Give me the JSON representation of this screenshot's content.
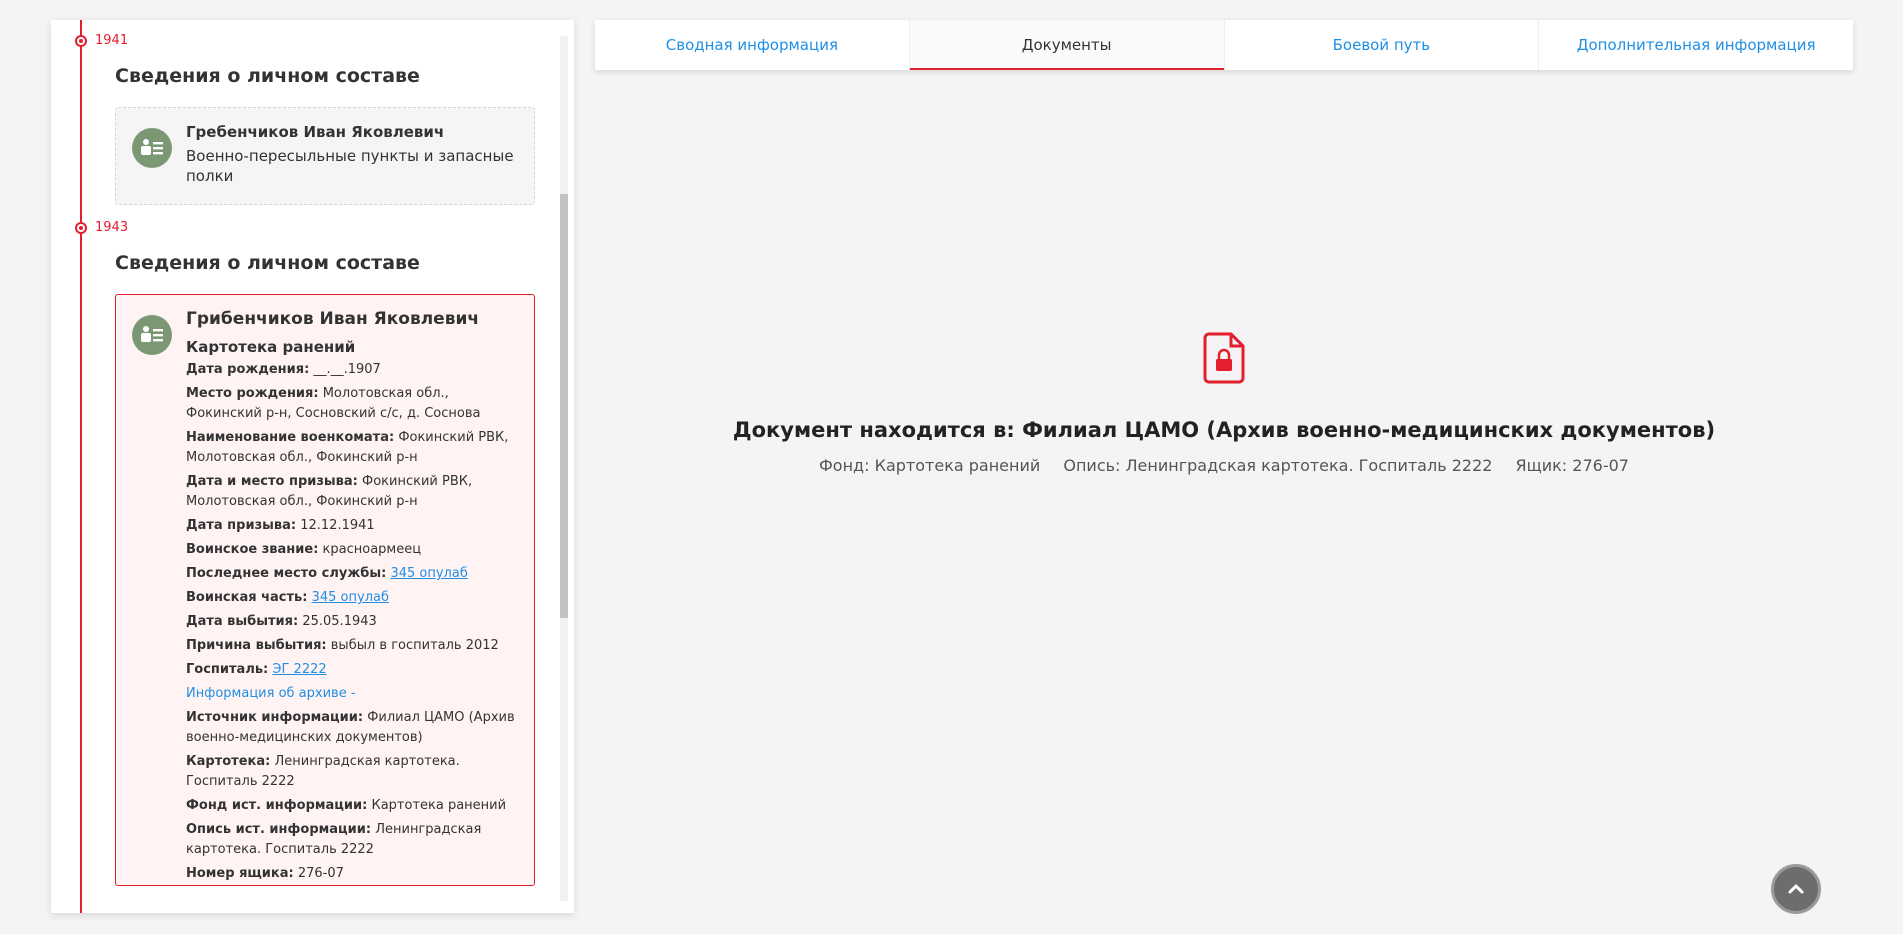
{
  "timeline": [
    {
      "year": "1941",
      "section_title": "Сведения о личном составе",
      "card": {
        "name": "Гребенчиков Иван Яковлевич",
        "subtitle": "Военно-пересыльные пункты и запасные полки"
      }
    },
    {
      "year": "1943",
      "section_title": "Сведения о личном составе",
      "card": {
        "name": "Грибенчиков Иван Яковлевич",
        "type": "Картотека ранений",
        "fields": {
          "birth_date": {
            "label": "Дата рождения:",
            "value": "__.__.1907"
          },
          "birth_place": {
            "label": "Место рождения:",
            "value": "Молотовская обл., Фокинский р-н, Сосновский с/с, д. Соснова"
          },
          "commissariat": {
            "label": "Наименование военкомата:",
            "value": "Фокинский РВК, Молотовская обл., Фокинский р-н"
          },
          "draft_date_place": {
            "label": "Дата и место призыва:",
            "value": "Фокинский РВК, Молотовская обл., Фокинский р-н"
          },
          "draft_date": {
            "label": "Дата призыва:",
            "value": "12.12.1941"
          },
          "rank": {
            "label": "Воинское звание:",
            "value": "красноармеец"
          },
          "last_service": {
            "label": "Последнее место службы:",
            "link": "345 опулаб"
          },
          "unit": {
            "label": "Воинская часть:",
            "link": "345 опулаб"
          },
          "leave_date": {
            "label": "Дата выбытия:",
            "value": "25.05.1943"
          },
          "leave_reason": {
            "label": "Причина выбытия:",
            "value": "выбыл в госпиталь 2012"
          },
          "hospital": {
            "label": "Госпиталь:",
            "link": "ЭГ 2222"
          },
          "archive_info": "Информация об архиве -",
          "source": {
            "label": "Источник информации:",
            "value": "Филиал ЦАМО (Архив военно-медицинских документов)"
          },
          "card_index": {
            "label": "Картотека:",
            "value": "Ленинградская картотека. Госпиталь 2222"
          },
          "fund": {
            "label": "Фонд ист. информации:",
            "value": "Картотека ранений"
          },
          "inventory": {
            "label": "Опись ист. информации:",
            "value": "Ленинградская картотека. Госпиталь 2222"
          },
          "box": {
            "label": "Номер ящика:",
            "value": "276-07"
          }
        }
      }
    }
  ],
  "tabs": [
    {
      "label": "Сводная информация",
      "active": false
    },
    {
      "label": "Документы",
      "active": true
    },
    {
      "label": "Боевой путь",
      "active": false
    },
    {
      "label": "Дополнительная информация",
      "active": false
    }
  ],
  "document": {
    "icon": "locked-document-icon",
    "title": "Документ находится в: Филиал ЦАМО (Архив военно-медицинских документов)",
    "fund": "Фонд: Картотека ранений",
    "inventory": "Опись: Ленинградская картотека. Госпиталь 2222",
    "box": "Ящик: 276-07"
  },
  "colors": {
    "accent": "#e31e2d",
    "link": "#1f8fe5",
    "avatar": "#7b9773"
  },
  "scroll_top_icon": "chevron-up-icon"
}
